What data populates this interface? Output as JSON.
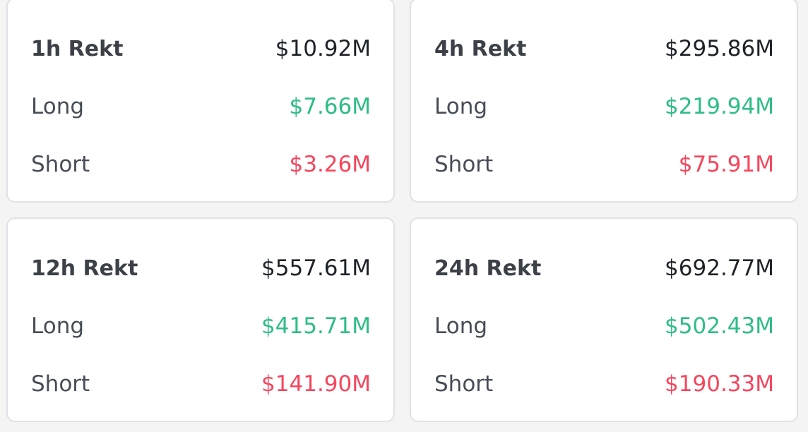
{
  "cards": [
    {
      "title": "1h Rekt",
      "total": "$10.92M",
      "long_label": "Long",
      "long_value": "$7.66M",
      "short_label": "Short",
      "short_value": "$3.26M"
    },
    {
      "title": "4h Rekt",
      "total": "$295.86M",
      "long_label": "Long",
      "long_value": "$219.94M",
      "short_label": "Short",
      "short_value": "$75.91M"
    },
    {
      "title": "12h Rekt",
      "total": "$557.61M",
      "long_label": "Long",
      "long_value": "$415.71M",
      "short_label": "Short",
      "short_value": "$141.90M"
    },
    {
      "title": "24h Rekt",
      "total": "$692.77M",
      "long_label": "Long",
      "long_value": "$502.43M",
      "short_label": "Short",
      "short_value": "$190.33M"
    }
  ],
  "colors": {
    "long": "#2ebd85",
    "short": "#f6465d",
    "total": "#1e2329"
  }
}
